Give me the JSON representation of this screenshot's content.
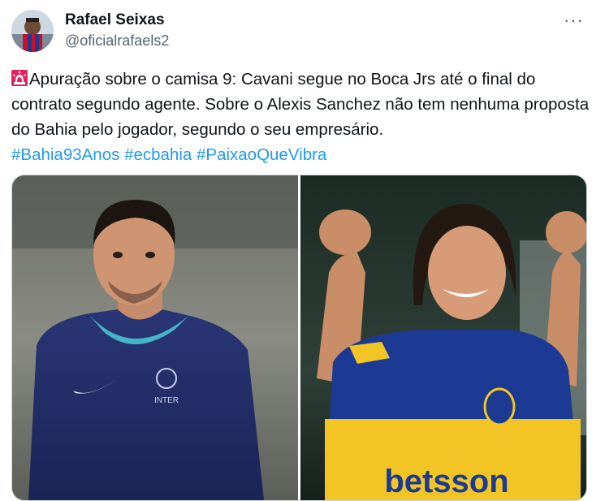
{
  "author": {
    "name": "Rafael Seixas",
    "handle": "@oficialrafaels2"
  },
  "more_icon": "more-horizontal-icon",
  "tweet": {
    "body": "Apuração sobre o camisa 9: Cavani segue no Boca Jrs até o final do contrato segundo agente. Sobre o Alexis Sanchez não tem nenhuma proposta do Bahia pelo jogador, segundo o seu empresário.",
    "hashtags": [
      "#Bahia93Anos",
      "#ecbahia",
      "#PaixaoQueVibra"
    ]
  },
  "media": {
    "jersey_left_brand": "INTER",
    "jersey_right_sponsor": "betsson"
  },
  "colors": {
    "link": "#1d9bf0",
    "secondary_text": "#536471",
    "siren": "#e0245e"
  }
}
